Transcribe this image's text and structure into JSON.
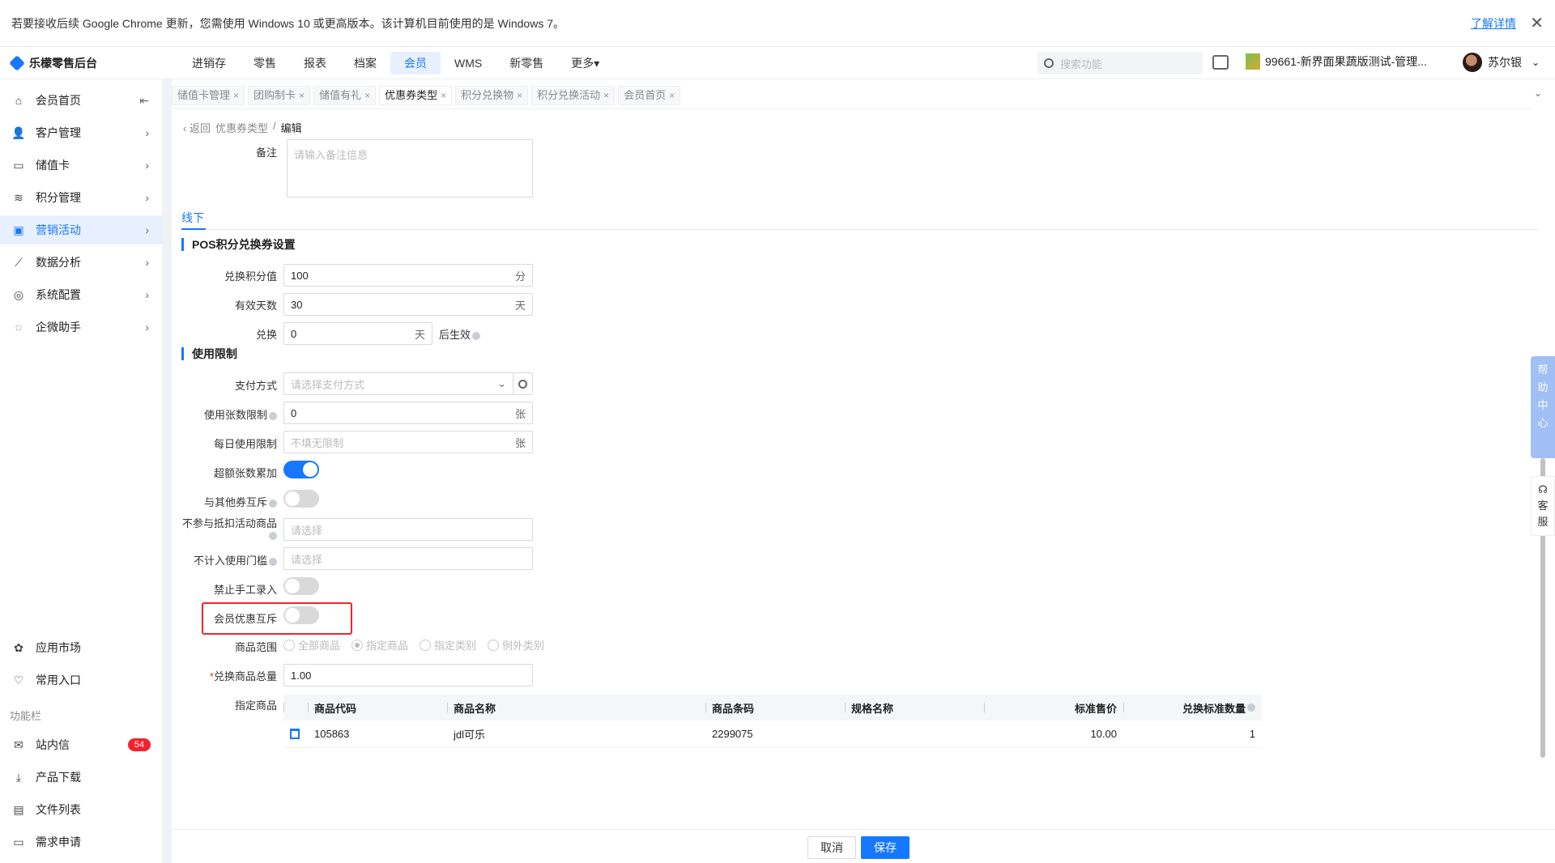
{
  "notice": {
    "text": "若要接收后续 Google Chrome 更新，您需使用 Windows 10 或更高版本。该计算机目前使用的是 Windows 7。",
    "link": "了解详情",
    "close": "✕"
  },
  "header": {
    "logo": "乐檬零售后台",
    "nav": [
      "进销存",
      "零售",
      "报表",
      "档案",
      "会员",
      "WMS",
      "新零售",
      "更多▾"
    ],
    "search_placeholder": "搜索功能",
    "store": "99661-新界面果蔬版测试-管理...",
    "user": "苏尔银",
    "user_chev": "⌄"
  },
  "sidebar": {
    "items": [
      {
        "label": "会员首页",
        "icon": "⌂",
        "arrow": "⇤"
      },
      {
        "label": "客户管理",
        "icon": "👤",
        "arrow": "›"
      },
      {
        "label": "储值卡",
        "icon": "▭",
        "arrow": "›"
      },
      {
        "label": "积分管理",
        "icon": "≋",
        "arrow": "›"
      },
      {
        "label": "营销活动",
        "icon": "▣",
        "arrow": "›"
      },
      {
        "label": "数据分析",
        "icon": "⟋",
        "arrow": "›"
      },
      {
        "label": "系统配置",
        "icon": "◎",
        "arrow": "›"
      },
      {
        "label": "企微助手",
        "icon": "◌",
        "arrow": "›"
      }
    ],
    "bottom": [
      {
        "label": "应用市场",
        "icon": "✿"
      },
      {
        "label": "常用入口",
        "icon": "♡"
      }
    ],
    "section": "功能栏",
    "func": [
      {
        "label": "站内信",
        "icon": "✉",
        "badge": "54"
      },
      {
        "label": "产品下载",
        "icon": "⤓"
      },
      {
        "label": "文件列表",
        "icon": "▤"
      },
      {
        "label": "需求申请",
        "icon": "▭"
      }
    ]
  },
  "tabs": {
    "items": [
      "储值卡管理",
      "团购制卡",
      "储值有礼",
      "优惠券类型",
      "积分兑换物",
      "积分兑换活动",
      "会员首页"
    ],
    "close": "×",
    "chev": "⌄"
  },
  "crumb": {
    "back": "‹ 返回",
    "parent": "优惠券类型",
    "sep": "/",
    "current": "编辑"
  },
  "form": {
    "remark_label": "备注",
    "remark_placeholder": "请输入备注信息",
    "subtab": "线下",
    "section1": "POS积分兑换券设置",
    "points_label": "兑换积分值",
    "points_value": "100",
    "points_unit": "分",
    "days_label": "有效天数",
    "days_value": "30",
    "days_unit": "天",
    "exchange_label": "兑换",
    "exchange_value": "0",
    "exchange_unit": "天",
    "exchange_after": "后生效",
    "section2": "使用限制",
    "pay_label": "支付方式",
    "pay_placeholder": "请选择支付方式",
    "limit_label": "使用张数限制",
    "limit_value": "0",
    "limit_unit": "张",
    "daily_label": "每日使用限制",
    "daily_placeholder": "不填无限制",
    "daily_unit": "张",
    "overlay_label": "超额张数累加",
    "mutex_label": "与其他券互斥",
    "exclude_label": "不参与抵扣活动商品",
    "exclude_placeholder": "请选择",
    "threshold_label": "不计入使用门槛",
    "threshold_placeholder": "请选择",
    "manual_label": "禁止手工录入",
    "member_label": "会员优惠互斥",
    "range_label": "商品范围",
    "range_options": [
      "全部商品",
      "指定商品",
      "指定类别",
      "例外类别"
    ],
    "total_label": "兑换商品总量",
    "total_req": "*",
    "total_value": "1.00",
    "goods_label": "指定商品"
  },
  "table": {
    "headers": [
      "商品代码",
      "商品名称",
      "商品条码",
      "规格名称",
      "标准售价",
      "兑换标准数量"
    ],
    "rows": [
      {
        "code": "105863",
        "name": "jdl可乐",
        "barcode": "2299075",
        "spec": "",
        "price": "10.00",
        "qty": "1"
      }
    ]
  },
  "footer": {
    "cancel": "取消",
    "save": "保存"
  },
  "float": {
    "help": [
      "帮",
      "助",
      "中",
      "心"
    ],
    "kefu": [
      "客",
      "服"
    ]
  },
  "toggles": {
    "overlay": true,
    "mutex": false,
    "manual": false,
    "member": false
  },
  "colors": {
    "accent": "#1677ff",
    "highlight": "#f5222d"
  }
}
